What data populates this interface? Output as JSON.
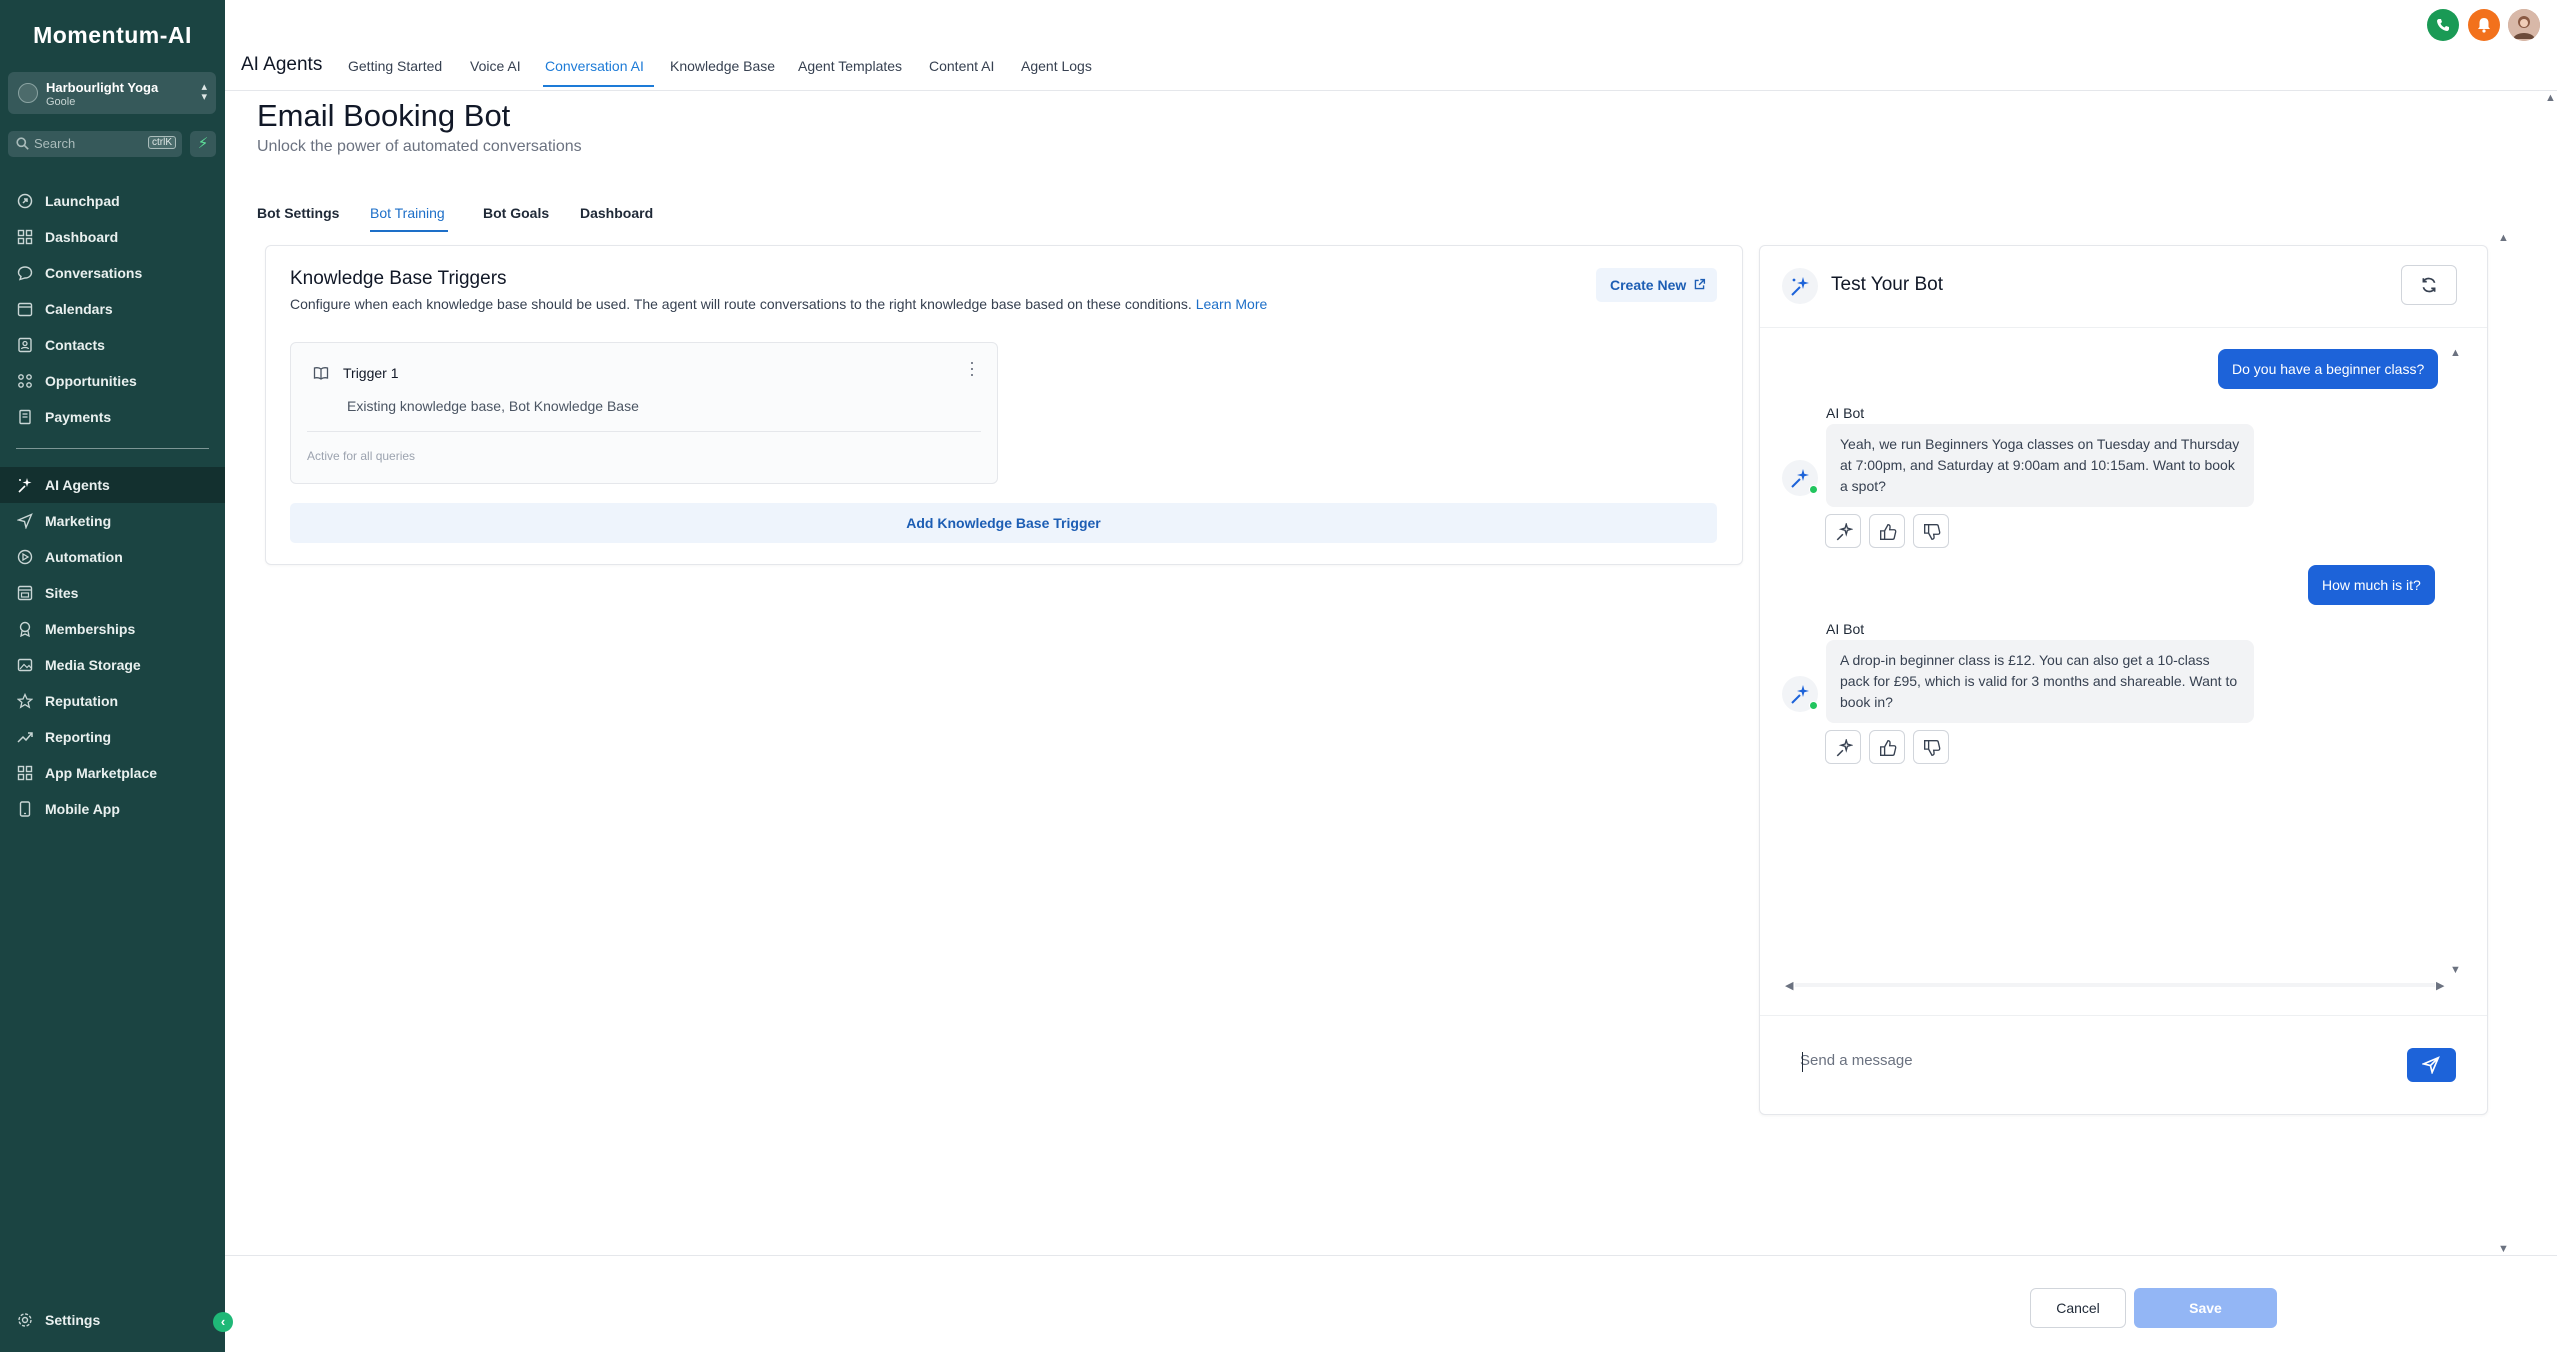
{
  "sidebar": {
    "logo": "Momentum-AI",
    "location": {
      "name": "Harbourlight Yoga",
      "sub": "Goole"
    },
    "search": {
      "placeholder": "Search",
      "shortcut": "ctrlK"
    },
    "items": [
      {
        "label": "Launchpad",
        "icon": "launchpad-icon"
      },
      {
        "label": "Dashboard",
        "icon": "dashboard-icon"
      },
      {
        "label": "Conversations",
        "icon": "chat-icon"
      },
      {
        "label": "Calendars",
        "icon": "calendar-icon"
      },
      {
        "label": "Contacts",
        "icon": "contacts-icon"
      },
      {
        "label": "Opportunities",
        "icon": "opportunities-icon"
      },
      {
        "label": "Payments",
        "icon": "payments-icon"
      }
    ],
    "items2": [
      {
        "label": "AI Agents",
        "icon": "sparkle-icon",
        "active": true
      },
      {
        "label": "Marketing",
        "icon": "send-icon"
      },
      {
        "label": "Automation",
        "icon": "automation-icon"
      },
      {
        "label": "Sites",
        "icon": "sites-icon"
      },
      {
        "label": "Memberships",
        "icon": "membership-icon"
      },
      {
        "label": "Media Storage",
        "icon": "media-icon"
      },
      {
        "label": "Reputation",
        "icon": "star-icon"
      },
      {
        "label": "Reporting",
        "icon": "reporting-icon"
      },
      {
        "label": "App Marketplace",
        "icon": "marketplace-icon"
      },
      {
        "label": "Mobile App",
        "icon": "mobile-icon"
      }
    ],
    "settings": "Settings"
  },
  "header": {
    "title": "AI Agents",
    "tabs": [
      "Getting Started",
      "Voice AI",
      "Conversation AI",
      "Knowledge Base",
      "Agent Templates",
      "Content AI",
      "Agent Logs"
    ],
    "active_tab": "Conversation AI"
  },
  "page": {
    "title": "Email Booking Bot",
    "subtitle": "Unlock the power of automated conversations",
    "tabs": [
      "Bot Settings",
      "Bot Training",
      "Bot Goals",
      "Dashboard"
    ],
    "active_tab": "Bot Training"
  },
  "kb": {
    "title": "Knowledge Base Triggers",
    "desc": "Configure when each knowledge base should be used. The agent will route conversations to the right knowledge base based on these conditions.",
    "learn_more": "Learn More",
    "create_new": "Create New",
    "trigger": {
      "name": "Trigger 1",
      "detail": "Existing knowledge base, Bot Knowledge Base",
      "scope": "Active for all queries"
    },
    "add_button": "Add Knowledge Base Trigger"
  },
  "test": {
    "title": "Test Your Bot",
    "messages": [
      {
        "from": "user",
        "text": "Do you have a beginner class?"
      },
      {
        "from": "bot",
        "label": "AI Bot",
        "text": "Yeah, we run Beginners Yoga classes on Tuesday and Thursday at 7:00pm, and Saturday at 9:00am and 10:15am. Want to book a spot?"
      },
      {
        "from": "user",
        "text": "How much is it?"
      },
      {
        "from": "bot",
        "label": "AI Bot",
        "text": "A drop-in beginner class is £12. You can also get a 10-class pack for £95, which is valid for 3 months and shareable. Want to book in?"
      }
    ],
    "input_placeholder": "Send a message"
  },
  "footer": {
    "cancel": "Cancel",
    "save": "Save"
  },
  "colors": {
    "sidebar": "#1b4442",
    "accent": "#1d63d9",
    "active_tab": "#1d7bd7"
  }
}
